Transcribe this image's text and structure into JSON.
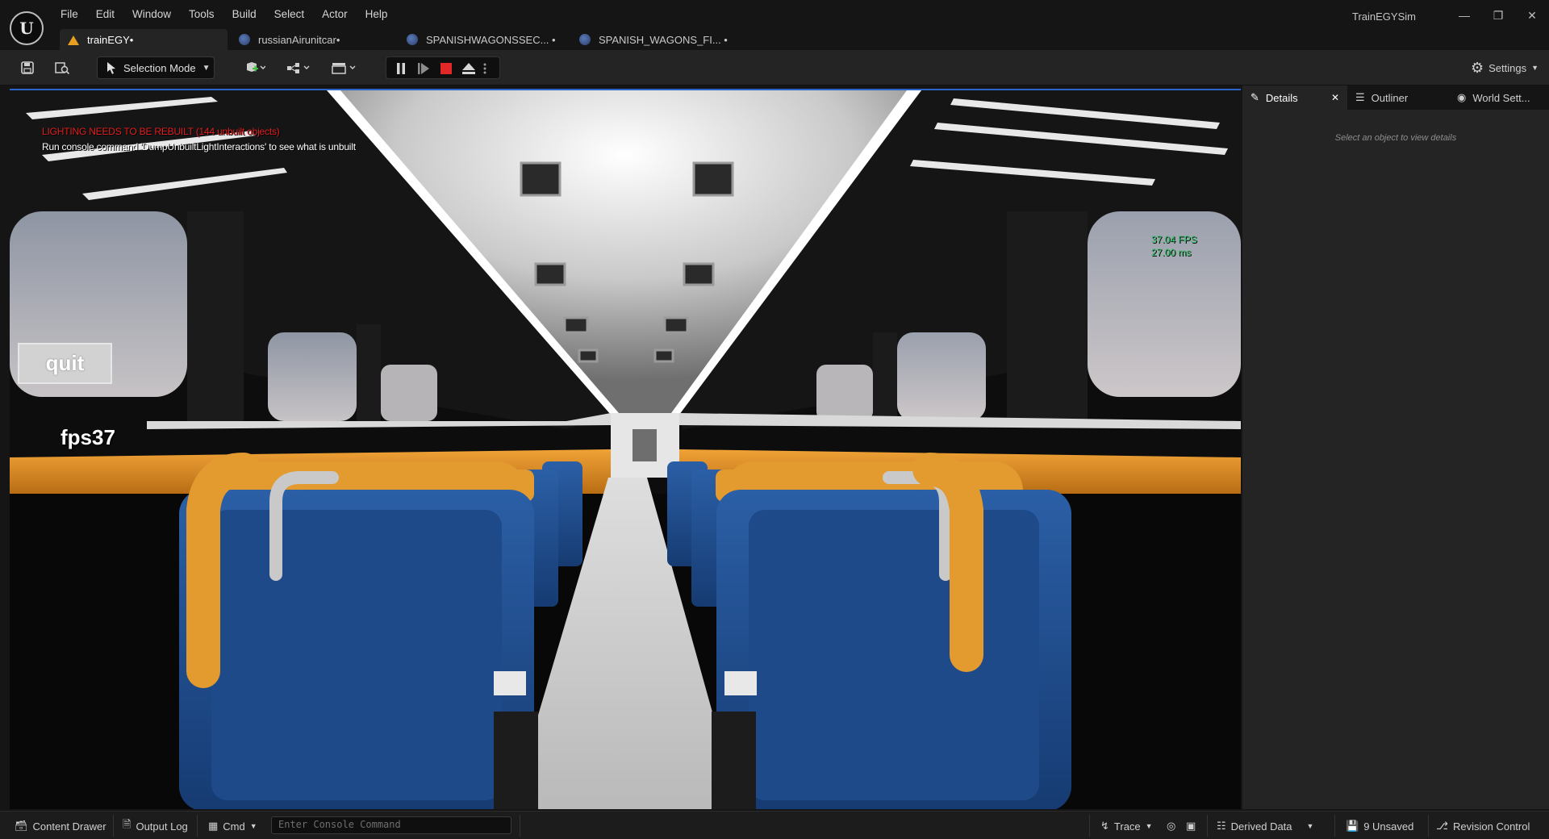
{
  "menu": [
    "File",
    "Edit",
    "Window",
    "Tools",
    "Build",
    "Select",
    "Actor",
    "Help"
  ],
  "app_title": "TrainEGYSim",
  "tabs": [
    {
      "label": "trainEGY•",
      "icon": "level-warning-icon"
    },
    {
      "label": "russianAirunitcar•",
      "icon": "level-icon"
    },
    {
      "label": "SPANISHWAGONSSEC... •",
      "icon": "level-icon"
    },
    {
      "label": "SPANISH_WAGONS_FI... •",
      "icon": "level-icon"
    }
  ],
  "toolbar": {
    "mode_label": "Selection Mode",
    "settings_label": "Settings"
  },
  "viewport": {
    "warning_line1": "LIGHTING NEEDS TO BE REBUILT (144 unbuilt objects)",
    "warning_line2": "Run console command 'DumpUnbuiltLightInteractions' to see what is unbuilt",
    "fps_stat": "37.04 FPS",
    "ms_stat": "27.00 ms",
    "quit_label": "quit",
    "fps_label": "fps37"
  },
  "panel": {
    "tabs": [
      "Details",
      "Outliner",
      "World Sett..."
    ],
    "hint": "Select an object to view details"
  },
  "statusbar": {
    "content_drawer": "Content Drawer",
    "output_log": "Output Log",
    "cmd": "Cmd",
    "console_placeholder": "Enter Console Command",
    "trace": "Trace",
    "derived_data": "Derived Data",
    "unsaved": "9 Unsaved",
    "revision_control": "Revision Control"
  },
  "colors": {
    "accent": "#2b64c8",
    "warning": "#e41e1e",
    "stat": "#2fc56a",
    "seat_blue": "#1f4a8a",
    "seat_orange": "#e39a2e"
  }
}
